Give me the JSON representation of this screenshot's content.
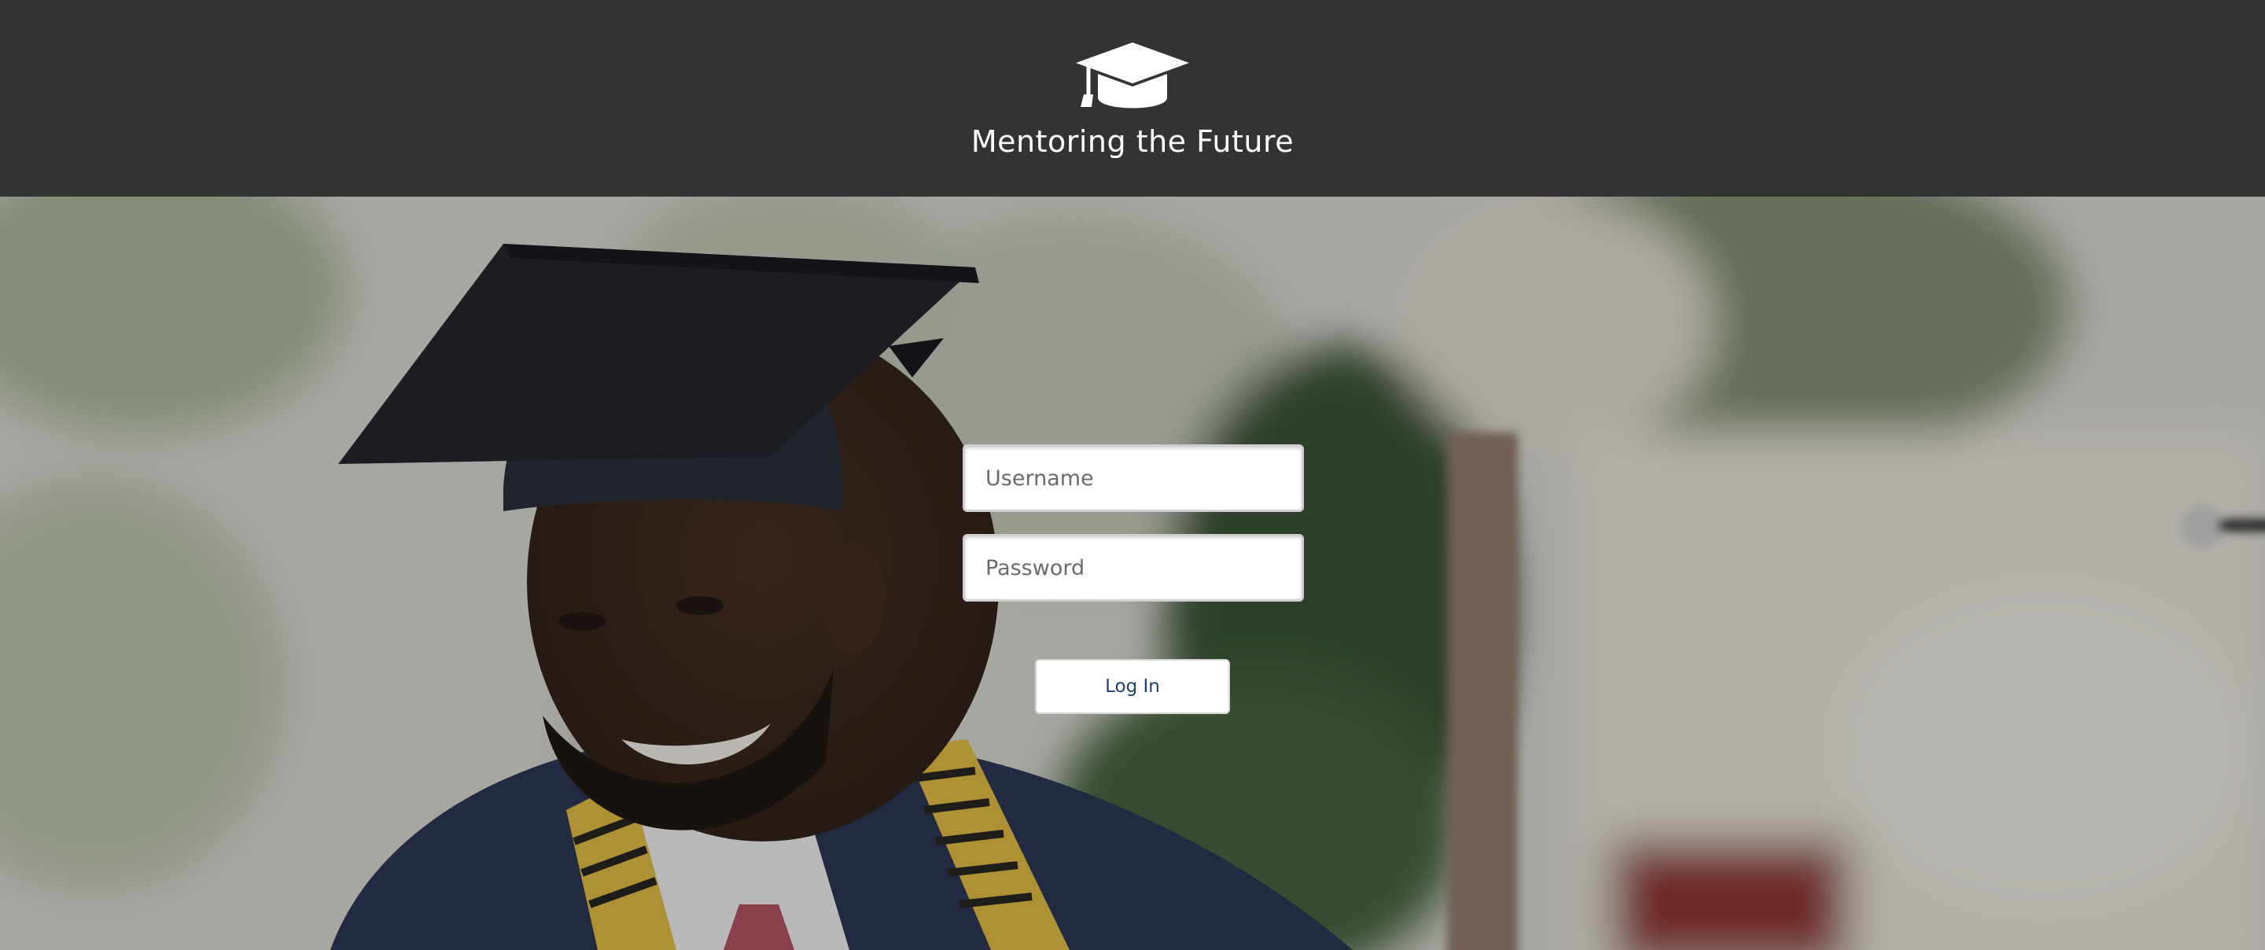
{
  "header": {
    "logo_icon": "graduation-cap-icon",
    "title": "Mentoring the Future",
    "background_color": "#333333"
  },
  "hero": {
    "image": "graduate-photo"
  },
  "login": {
    "username_placeholder": "Username",
    "username_value": "",
    "password_placeholder": "Password",
    "password_value": "",
    "submit_label": "Log In",
    "accent_color": "#1f3f72"
  }
}
